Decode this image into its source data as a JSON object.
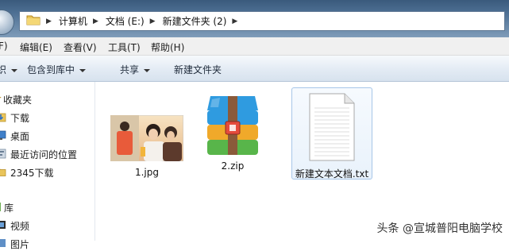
{
  "address_bar": {
    "breadcrumbs": [
      "计算机",
      "文档 (E:)",
      "新建文件夹 (2)"
    ]
  },
  "menu": {
    "items": [
      "F)",
      "编辑(E)",
      "查看(V)",
      "工具(T)",
      "帮助(H)"
    ]
  },
  "toolbar": {
    "organize_partial": "织",
    "include_in_library": "包含到库中",
    "share": "共享",
    "new_folder": "新建文件夹"
  },
  "nav": {
    "favorites_header": "收藏夹",
    "favorites": [
      "下载",
      "桌面",
      "最近访问的位置",
      "2345下载"
    ],
    "libraries_header": "库",
    "libraries": [
      "视频",
      "图片"
    ]
  },
  "files": [
    {
      "name": "1.jpg",
      "icon": "image-thumbnail"
    },
    {
      "name": "2.zip",
      "icon": "winrar-archive-icon"
    },
    {
      "name": "新建文本文档.txt",
      "icon": "text-document-icon",
      "selected": true
    }
  ],
  "watermark": "头条 @宣城普阳电脑学校",
  "colors": {
    "toolbar_bg": "#dfe8f2",
    "selection_border": "#a7c6e8",
    "zip_blue": "#2f9be0",
    "zip_orange": "#f0a92a",
    "zip_green": "#58b54a",
    "zip_red": "#e54b3c"
  }
}
